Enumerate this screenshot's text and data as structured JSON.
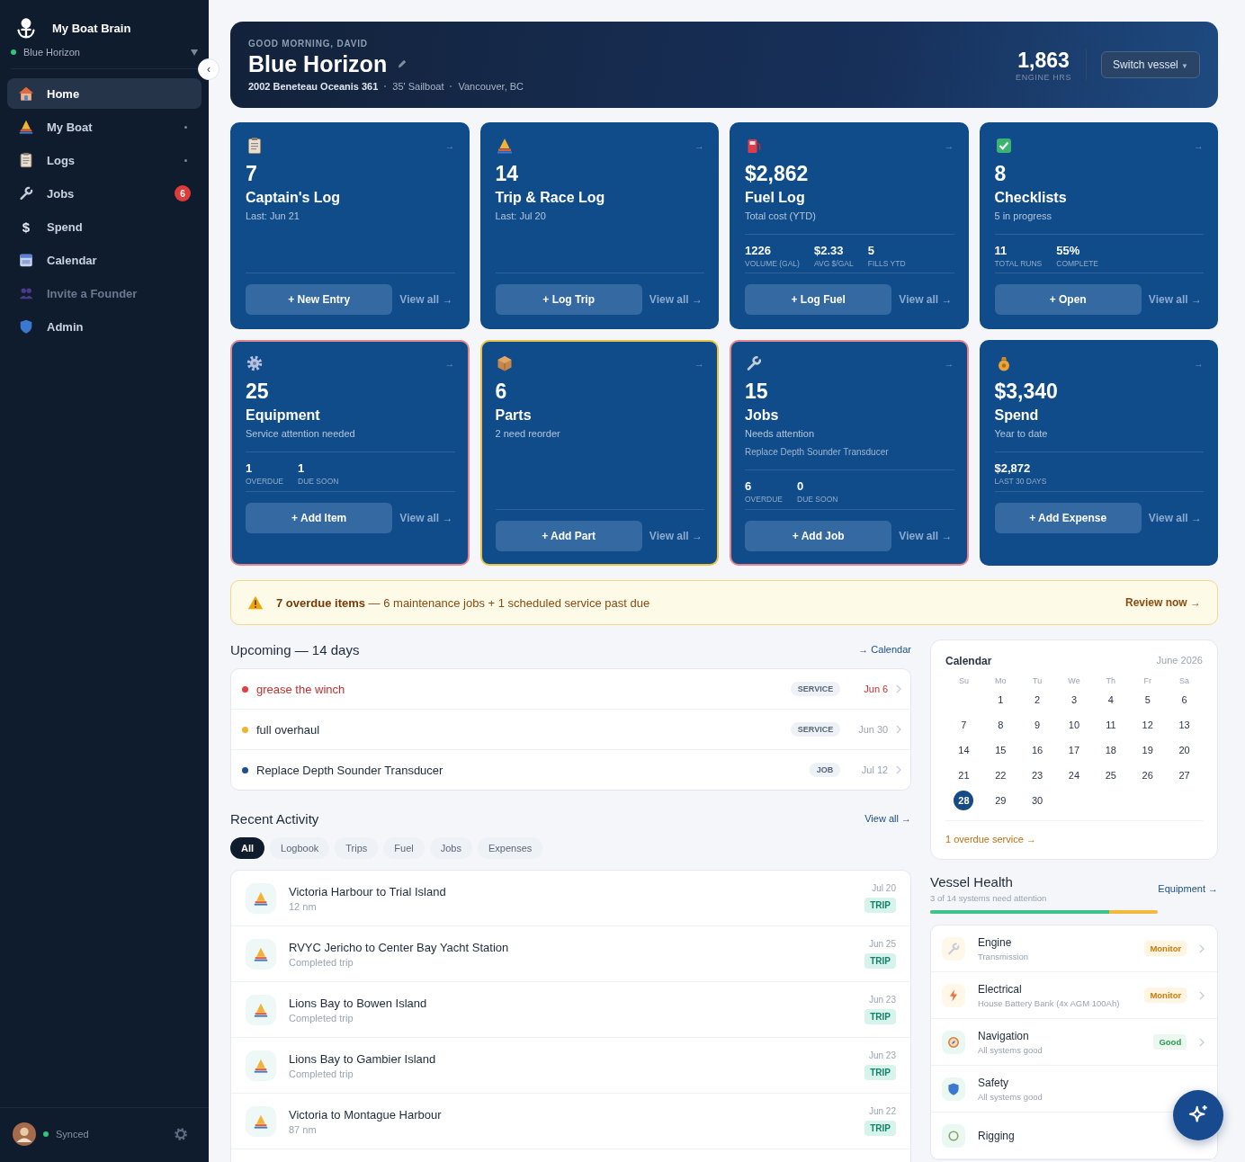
{
  "sidebar": {
    "app_name": "My Boat Brain",
    "vessel": "Blue Horizon",
    "collapse": "‹",
    "items": [
      {
        "label": "Home",
        "selected": true,
        "submenu": false,
        "muted": false
      },
      {
        "label": "My Boat",
        "selected": false,
        "submenu": true,
        "muted": false
      },
      {
        "label": "Logs",
        "selected": false,
        "submenu": true,
        "muted": false
      },
      {
        "label": "Jobs",
        "selected": false,
        "submenu": false,
        "muted": false,
        "badge": "6"
      },
      {
        "label": "Spend",
        "selected": false,
        "submenu": false,
        "muted": false,
        "glyph": "$"
      },
      {
        "label": "Calendar",
        "selected": false,
        "submenu": false,
        "muted": false
      },
      {
        "label": "Invite a Founder",
        "selected": false,
        "submenu": false,
        "muted": true
      },
      {
        "label": "Admin",
        "selected": false,
        "submenu": false,
        "muted": false
      }
    ],
    "status": "Synced"
  },
  "header": {
    "greeting": "GOOD MORNING, DAVID",
    "title": "Blue Horizon",
    "details": [
      "2002 Beneteau Oceanis 361",
      "35' Sailboat",
      "Vancouver, BC"
    ],
    "stat_value": "1,863",
    "stat_label": "ENGINE HRS",
    "switch_button": "Switch vessel",
    "switch_caret": "▼"
  },
  "cards": [
    {
      "value": "7",
      "title": "Captain's Log",
      "subtitle": "Last: Jun 21",
      "action": "+ New Entry",
      "link": "View all →",
      "arrow": "→"
    },
    {
      "value": "14",
      "title": "Trip & Race Log",
      "subtitle": "Last: Jul 20",
      "action": "+ Log Trip",
      "link": "View all →",
      "arrow": "→"
    },
    {
      "value": "$2,862",
      "title": "Fuel Log",
      "subtitle": "Total cost (YTD)",
      "stats": [
        {
          "value": "1226",
          "label": "VOLUME (GAL)"
        },
        {
          "value": "$2.33",
          "label": "AVG $/GAL"
        },
        {
          "value": "5",
          "label": "FILLS YTD"
        }
      ],
      "action": "+ Log Fuel",
      "link": "View all →",
      "arrow": "→"
    },
    {
      "value": "8",
      "title": "Checklists",
      "subtitle": "5 in progress",
      "stats": [
        {
          "value": "11",
          "label": "TOTAL RUNS"
        },
        {
          "value": "55%",
          "label": "COMPLETE"
        }
      ],
      "action": "+ Open",
      "link": "View all →",
      "arrow": "→"
    },
    {
      "value": "25",
      "title": "Equipment",
      "subtitle": "Service attention needed",
      "color": "#e58590",
      "stats": [
        {
          "value": "1",
          "label": "OVERDUE"
        },
        {
          "value": "1",
          "label": "DUE SOON"
        }
      ],
      "action": "+ Add Item",
      "link": "View all →",
      "arrow": "→"
    },
    {
      "value": "6",
      "title": "Parts",
      "subtitle": "2 need reorder",
      "color": "#e8c344",
      "action": "+ Add Part",
      "link": "View all →",
      "arrow": "→"
    },
    {
      "value": "15",
      "title": "Jobs",
      "subtitle": "Needs attention",
      "note": "Replace Depth Sounder Transducer",
      "color": "#e58590",
      "stats": [
        {
          "value": "6",
          "label": "OVERDUE"
        },
        {
          "value": "0",
          "label": "DUE SOON"
        }
      ],
      "action": "+ Add Job",
      "link": "View all →",
      "arrow": "→"
    },
    {
      "value": "$3,340",
      "title": "Spend",
      "subtitle": "Year to date",
      "stats": [
        {
          "value": "$2,872",
          "label": "LAST 30 DAYS"
        }
      ],
      "action": "+ Add Expense",
      "link": "View all →",
      "arrow": "→"
    }
  ],
  "banner": {
    "text": "**7 overdue items** — 6 maintenance jobs + 1 scheduled service past due",
    "link": "Review now →"
  },
  "upcoming": {
    "title": "Upcoming — 14 days",
    "link": "→ Calendar",
    "items": [
      {
        "title": "grease the winch",
        "tag": "SERVICE",
        "date": "Jun 6",
        "color": "#e53e3e",
        "overdue": true
      },
      {
        "title": "full overhaul",
        "tag": "SERVICE",
        "date": "Jun 30",
        "color": "#f0b429",
        "overdue": false
      },
      {
        "title": "Replace Depth Sounder Transducer",
        "tag": "JOB",
        "date": "Jul 12",
        "color": "#1e4e8c",
        "overdue": false
      }
    ]
  },
  "activity": {
    "title": "Recent Activity",
    "link": "View all →",
    "filters": [
      {
        "label": "All",
        "selected": true
      },
      {
        "label": "Logbook",
        "selected": false
      },
      {
        "label": "Trips",
        "selected": false
      },
      {
        "label": "Fuel",
        "selected": false
      },
      {
        "label": "Jobs",
        "selected": false
      },
      {
        "label": "Expenses",
        "selected": false
      }
    ],
    "items": [
      {
        "title": "Victoria Harbour to Trial Island",
        "subtitle": "12 nm",
        "date": "Jul 20",
        "tag": "TRIP"
      },
      {
        "title": "RVYC Jericho to Center Bay Yacht Station",
        "subtitle": "Completed trip",
        "date": "Jun 25",
        "tag": "TRIP"
      },
      {
        "title": "Lions Bay to Bowen Island",
        "subtitle": "Completed trip",
        "date": "Jun 23",
        "tag": "TRIP"
      },
      {
        "title": "Lions Bay to Gambier Island",
        "subtitle": "Completed trip",
        "date": "Jun 23",
        "tag": "TRIP"
      },
      {
        "title": "Victoria to Montague Harbour",
        "subtitle": "87 nm",
        "date": "Jun 22",
        "tag": "TRIP"
      }
    ]
  },
  "calendar": {
    "title": "Calendar",
    "month": "June 2026",
    "weekdays": [
      "Su",
      "Mo",
      "Tu",
      "We",
      "Th",
      "Fr",
      "Sa"
    ],
    "weeks": [
      {
        "align_end": true,
        "days": [
          {
            "day": "1",
            "selected": false
          },
          {
            "day": "2",
            "selected": false
          },
          {
            "day": "3",
            "selected": false
          },
          {
            "day": "4",
            "selected": false
          },
          {
            "day": "5",
            "selected": false
          },
          {
            "day": "6",
            "selected": false
          }
        ]
      },
      {
        "days": [
          {
            "day": "7",
            "selected": false
          },
          {
            "day": "8",
            "selected": false
          },
          {
            "day": "9",
            "selected": false
          },
          {
            "day": "10",
            "selected": false
          },
          {
            "day": "11",
            "selected": false
          },
          {
            "day": "12",
            "selected": false
          },
          {
            "day": "13",
            "selected": false
          }
        ]
      },
      {
        "days": [
          {
            "day": "14",
            "selected": false
          },
          {
            "day": "15",
            "selected": false
          },
          {
            "day": "16",
            "selected": false
          },
          {
            "day": "17",
            "selected": false
          },
          {
            "day": "18",
            "selected": false
          },
          {
            "day": "19",
            "selected": false
          },
          {
            "day": "20",
            "selected": false
          }
        ]
      },
      {
        "days": [
          {
            "day": "21",
            "selected": false
          },
          {
            "day": "22",
            "selected": false
          },
          {
            "day": "23",
            "selected": false
          },
          {
            "day": "24",
            "selected": false
          },
          {
            "day": "25",
            "selected": false
          },
          {
            "day": "26",
            "selected": false
          },
          {
            "day": "27",
            "selected": false
          }
        ]
      },
      {
        "align_end": false,
        "days": [
          {
            "day": "28",
            "selected": true
          },
          {
            "day": "29",
            "selected": false
          },
          {
            "day": "30",
            "selected": false
          }
        ]
      }
    ],
    "footer": "1 overdue service →"
  },
  "health": {
    "title": "Vessel Health",
    "subtitle": "3 of 14 systems need attention",
    "link": "Equipment →",
    "bar": {
      "level": 0.786
    },
    "systems": [
      {
        "name": "Engine",
        "detail": "Transmission",
        "status": "Monitor",
        "kind": "monitor"
      },
      {
        "name": "Electrical",
        "detail": "House Battery Bank (4x AGM 100Ah)",
        "status": "Monitor",
        "kind": "monitor"
      },
      {
        "name": "Navigation",
        "detail": "All systems good",
        "status": "Good",
        "kind": "good"
      },
      {
        "name": "Safety",
        "detail": "All systems good",
        "kind": "good"
      },
      {
        "name": "Rigging",
        "kind": "good"
      }
    ]
  }
}
